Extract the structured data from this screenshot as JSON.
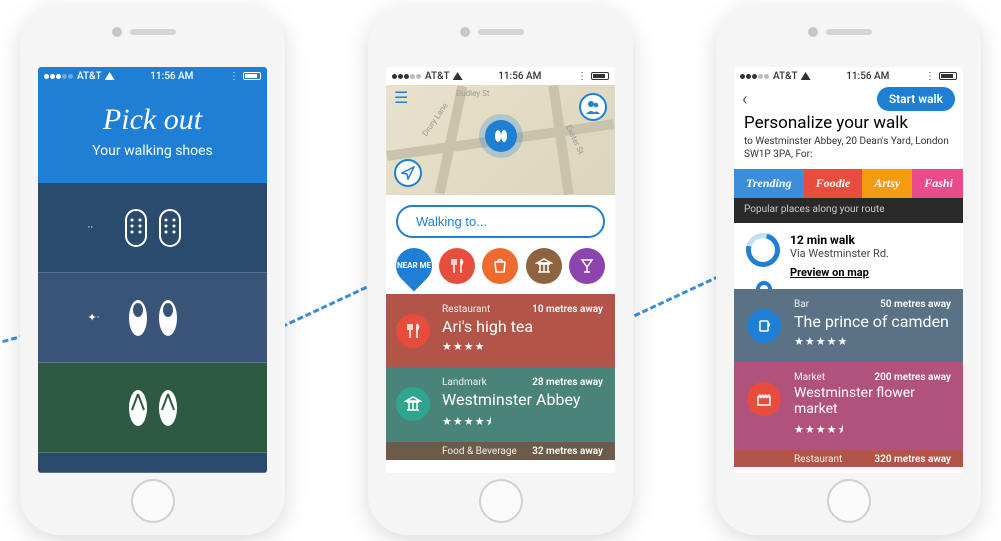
{
  "status": {
    "carrier": "AT&T",
    "time": "11:56 AM"
  },
  "screen1": {
    "title": "Pick out",
    "subtitle": "Your walking shoes"
  },
  "screen2": {
    "search_placeholder": "Walking to...",
    "nearme": "NEAR ME",
    "places": [
      {
        "category": "Restaurant",
        "name": "Ari's high tea",
        "distance": "10 metres away",
        "stars": "★★★★"
      },
      {
        "category": "Landmark",
        "name": "Westminster Abbey",
        "distance": "28 metres away",
        "stars": "★★★★⯨"
      },
      {
        "category": "Food & Beverage",
        "name": "",
        "distance": "32 metres away",
        "stars": ""
      }
    ]
  },
  "screen3": {
    "start_button": "Start walk",
    "title": "Personalize your walk",
    "subtitle": "to Westminster Abbey, 20 Dean's Yard, London SW1P 3PA, For:",
    "tabs": [
      "Trending",
      "Foodie",
      "Artsy",
      "Fashi"
    ],
    "tabs_sub": "Popular places along your route",
    "walk": {
      "duration": "12 min walk",
      "via": "Via Westminster Rd.",
      "preview": "Preview on map"
    },
    "places": [
      {
        "category": "Bar",
        "name": "The prince of camden",
        "distance": "50 metres away",
        "stars": "★★★★★"
      },
      {
        "category": "Market",
        "name": "Westminster flower market",
        "distance": "200 metres away",
        "stars": "★★★★⯨"
      },
      {
        "category": "Restaurant",
        "name": "",
        "distance": "320 metres away",
        "stars": ""
      }
    ]
  }
}
